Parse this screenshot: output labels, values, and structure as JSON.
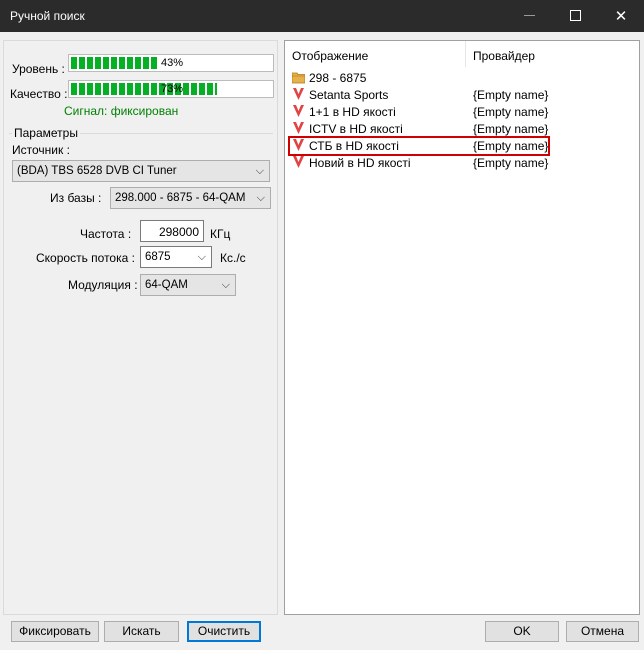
{
  "window": {
    "title": "Ручной поиск"
  },
  "signal": {
    "level_label": "Уровень :",
    "level_value": 0.43,
    "level_text": "43%",
    "quality_label": "Качество :",
    "quality_value": 0.73,
    "quality_text": "73%",
    "status": "Сигнал: фиксирован",
    "bar_color": "#06b025"
  },
  "params": {
    "group_title": "Параметры",
    "source_label": "Источник :",
    "source_value": "(BDA) TBS 6528 DVB CI Tuner",
    "from_base_label": "Из базы :",
    "from_base_value": "298.000 - 6875 -  64-QAM",
    "frequency_label": "Частота :",
    "frequency_value": "298000",
    "frequency_unit": "КГц",
    "symbolrate_label": "Скорость потока :",
    "symbolrate_value": "6875",
    "symbolrate_unit": "Кс./с",
    "modulation_label": "Модуляция :",
    "modulation_value": "64-QAM"
  },
  "list": {
    "columns": [
      "Отображение",
      "Провайдер"
    ],
    "rows": [
      {
        "name": "298 - 6875",
        "provider": "",
        "icon": "folder-icon"
      },
      {
        "name": "Setanta Sports",
        "provider": "{Empty name}",
        "icon": "tv-channel-icon"
      },
      {
        "name": "1+1 в HD якості",
        "provider": "{Empty name}",
        "icon": "tv-channel-icon"
      },
      {
        "name": "ICTV в HD якості",
        "provider": "{Empty name}",
        "icon": "tv-channel-icon"
      },
      {
        "name": "СТБ в HD якості",
        "provider": "{Empty name}",
        "icon": "tv-channel-icon"
      },
      {
        "name": "Новий в HD якості",
        "provider": "{Empty name}",
        "icon": "tv-channel-icon"
      }
    ],
    "highlight_color": "#d00000"
  },
  "buttons": {
    "fix": "Фиксировать",
    "search": "Искать",
    "clear": "Очистить",
    "ok": "OK",
    "cancel": "Отмена"
  }
}
